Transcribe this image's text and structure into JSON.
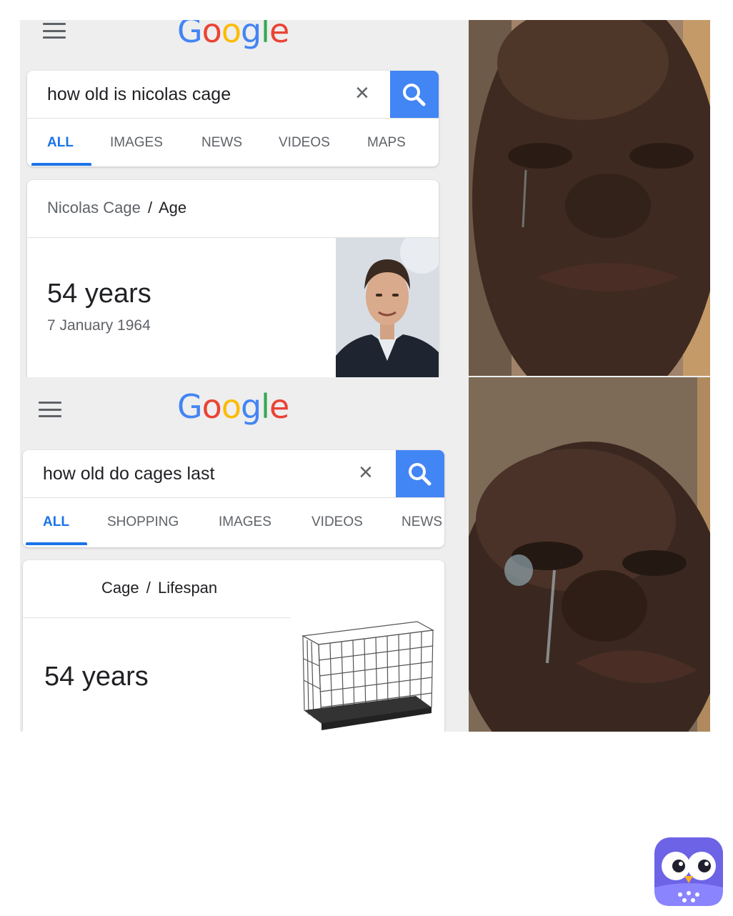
{
  "top_panel": {
    "logo": [
      "G",
      "o",
      "o",
      "g",
      "l",
      "e"
    ],
    "search": {
      "query": "how old is nicolas cage",
      "clear_symbol": "×"
    },
    "tabs": [
      "ALL",
      "IMAGES",
      "NEWS",
      "VIDEOS",
      "MAPS"
    ],
    "active_tab": "ALL",
    "result": {
      "subject": "Nicolas Cage",
      "separator": "/",
      "attribute": "Age",
      "value": "54 years",
      "detail": "7 January 1964"
    }
  },
  "bottom_panel": {
    "logo": [
      "G",
      "o",
      "o",
      "g",
      "l",
      "e"
    ],
    "search": {
      "query": "how old do cages last",
      "clear_symbol": "×"
    },
    "tabs": [
      "ALL",
      "SHOPPING",
      "IMAGES",
      "VIDEOS",
      "NEWS"
    ],
    "active_tab": "ALL",
    "result": {
      "subject": "Cage",
      "separator": "/",
      "attribute": "Lifespan",
      "value": "54 years"
    }
  },
  "colors": {
    "google_blue": "#4285f4",
    "google_red": "#ea4335",
    "google_yellow": "#fbbc05",
    "google_green": "#34a853",
    "tab_active": "#1a73e8"
  },
  "icons": [
    "menu-icon",
    "search-icon",
    "close-icon",
    "owl-app-icon"
  ]
}
